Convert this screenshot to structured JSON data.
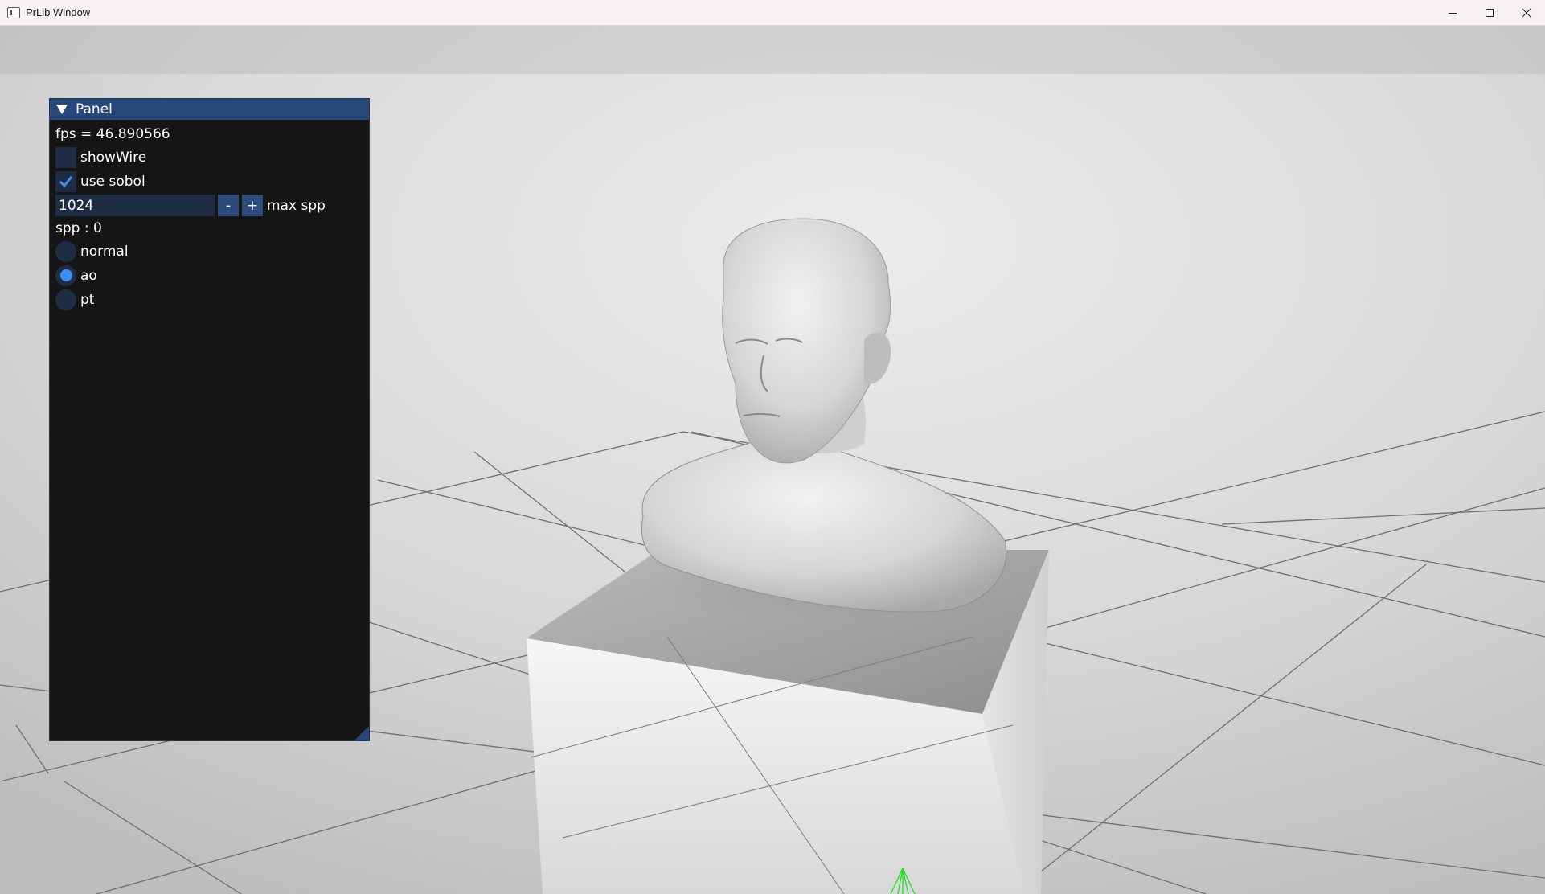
{
  "window": {
    "title": "PrLib Window",
    "icon": "app-window-icon",
    "controls": [
      "minimize-icon",
      "maximize-icon",
      "close-icon"
    ]
  },
  "panel": {
    "title": "Panel",
    "fps_text": "fps = 46.890566",
    "show_wire": {
      "label": "showWire",
      "checked": false
    },
    "use_sobol": {
      "label": "use sobol",
      "checked": true
    },
    "max_spp": {
      "value": "1024",
      "minus": "-",
      "plus": "+",
      "label": "max spp"
    },
    "spp_text": "spp : 0",
    "render_modes": [
      {
        "label": "normal",
        "selected": false
      },
      {
        "label": "ao",
        "selected": true
      },
      {
        "label": "pt",
        "selected": false
      }
    ]
  },
  "colors": {
    "panel_header": "#29487a",
    "frame_bg": "#1f2d44",
    "accent": "#3d8ef2",
    "gizmo": "#22dd22"
  }
}
